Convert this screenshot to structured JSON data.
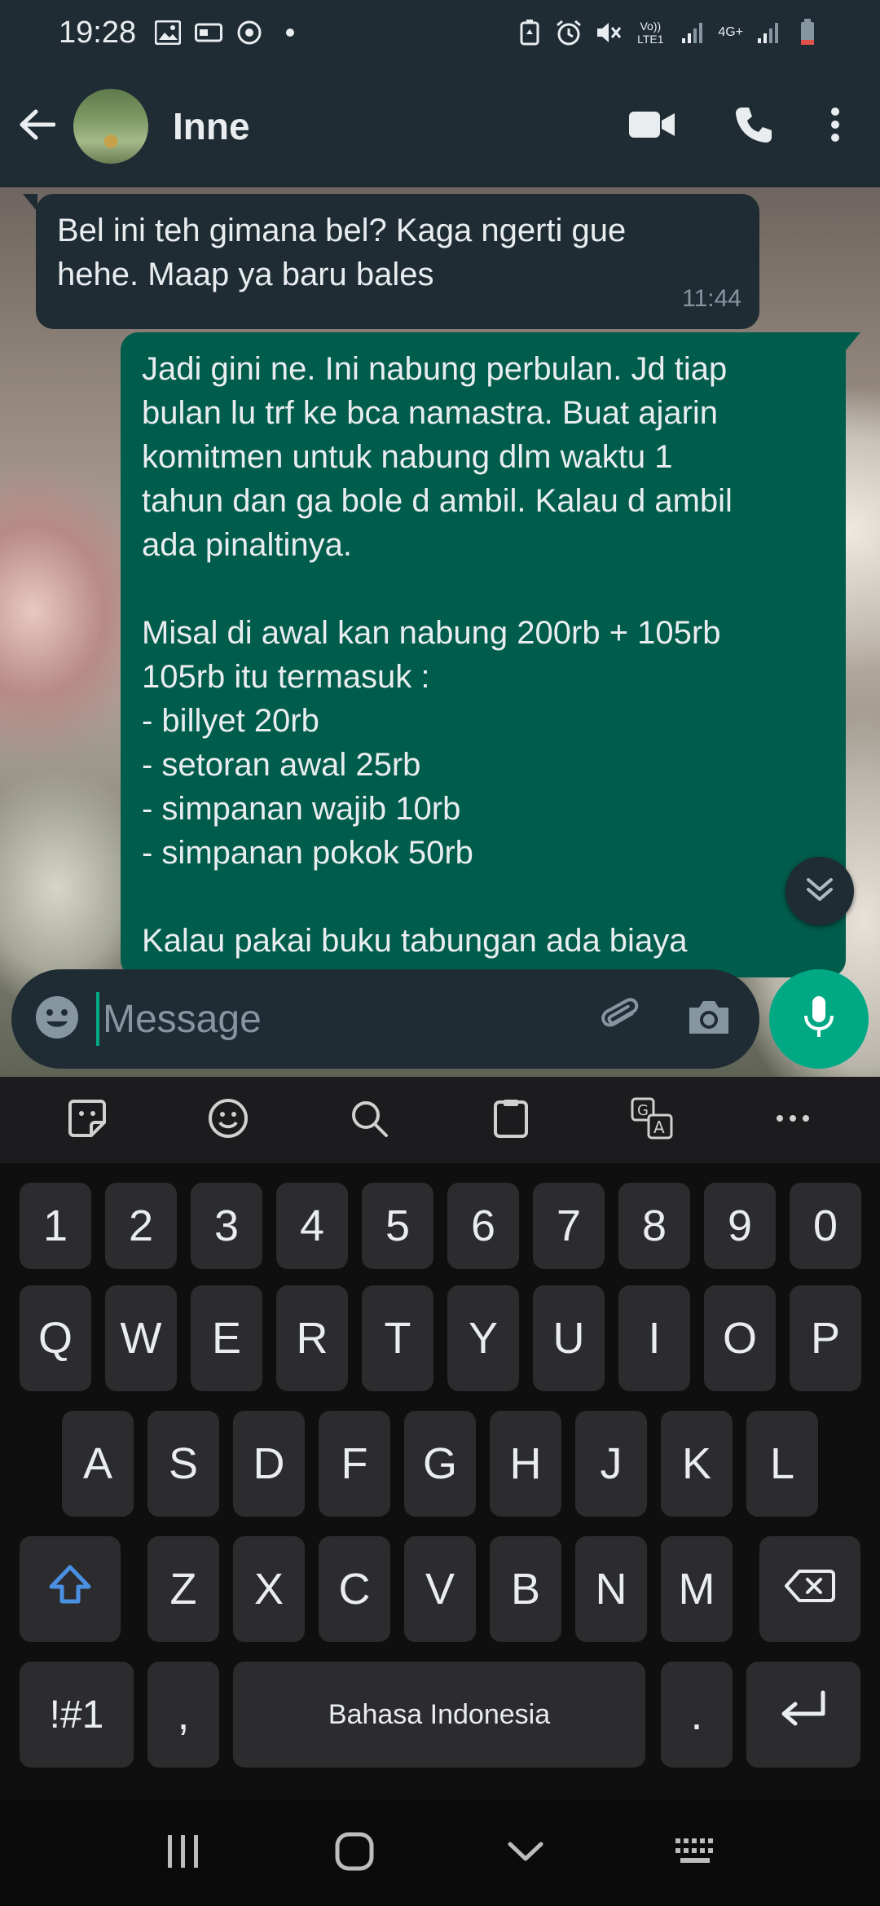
{
  "status_bar": {
    "time": "19:28",
    "volte_label": "Vo)) LTE1",
    "network_label": "4G+"
  },
  "header": {
    "contact_name": "Inne"
  },
  "messages": [
    {
      "direction": "incoming",
      "lines": [
        "Bel ini teh gimana bel? Kaga ngerti gue",
        "hehe. Maap ya baru bales"
      ],
      "time": "11:44"
    },
    {
      "direction": "outgoing",
      "lines": [
        "Jadi gini ne. Ini nabung perbulan. Jd tiap",
        "bulan lu trf ke bca namastra. Buat ajarin",
        "komitmen untuk nabung dlm waktu 1",
        "tahun dan ga bole d ambil. Kalau d ambil",
        "ada pinaltinya.",
        "",
        "Misal di awal kan nabung 200rb + 105rb",
        "105rb itu termasuk :",
        "- billyet 20rb",
        "- setoran awal 25rb",
        "- simpanan wajib 10rb",
        "- simpanan pokok 50rb",
        "",
        "Kalau pakai buku tabungan ada biaya"
      ]
    }
  ],
  "compose": {
    "placeholder": "Message"
  },
  "keyboard": {
    "number_row": [
      "1",
      "2",
      "3",
      "4",
      "5",
      "6",
      "7",
      "8",
      "9",
      "0"
    ],
    "row1": [
      "Q",
      "W",
      "E",
      "R",
      "T",
      "Y",
      "U",
      "I",
      "O",
      "P"
    ],
    "row2": [
      "A",
      "S",
      "D",
      "F",
      "G",
      "H",
      "J",
      "K",
      "L"
    ],
    "row3": [
      "Z",
      "X",
      "C",
      "V",
      "B",
      "N",
      "M"
    ],
    "symbols_key": "!#1",
    "comma_key": ",",
    "space_label": "Bahasa Indonesia",
    "period_key": "."
  },
  "colors": {
    "accent": "#00a884",
    "outgoing_bubble": "#005c4b",
    "incoming_bubble": "#1f2c34",
    "header": "#1f2c34",
    "shift_icon": "#4a90e2"
  },
  "icons": {
    "back": "arrow-left-icon",
    "video": "video-call-icon",
    "call": "phone-icon",
    "menu": "more-vertical-icon",
    "emoji": "emoji-icon",
    "attach": "paperclip-icon",
    "camera": "camera-icon",
    "mic": "microphone-icon",
    "scroll_down": "double-chevron-down-icon"
  }
}
